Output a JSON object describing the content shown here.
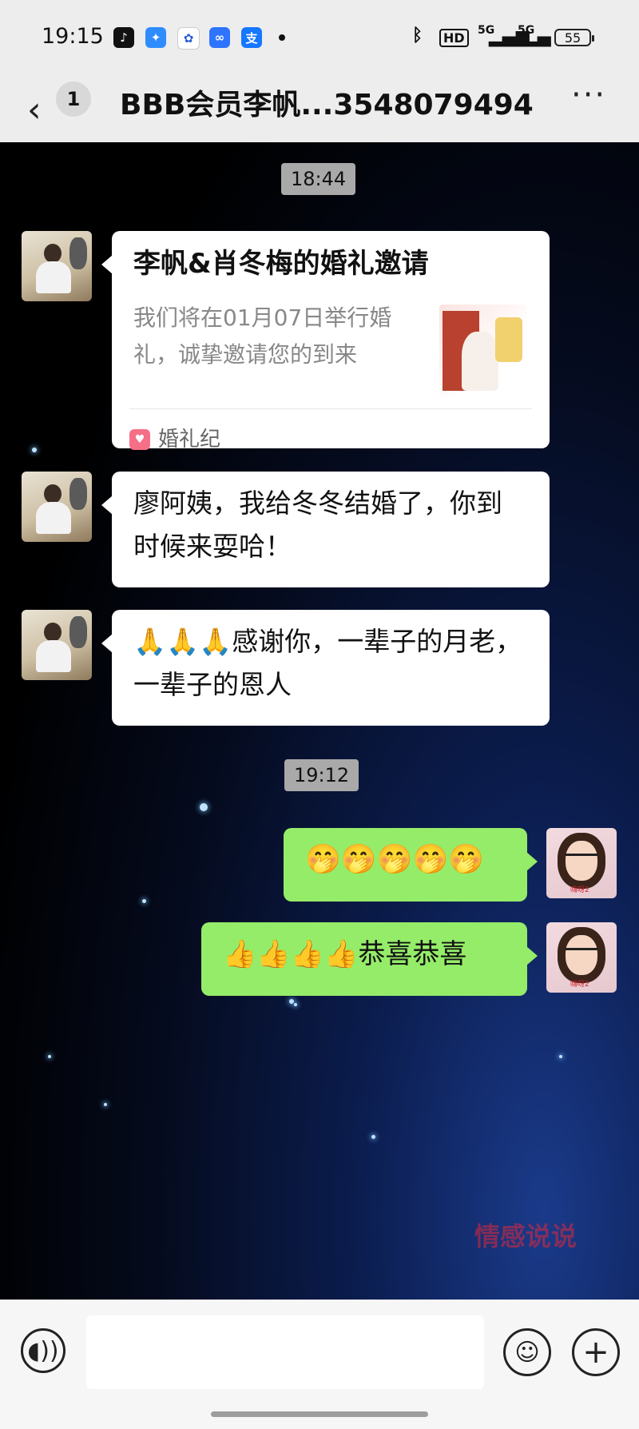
{
  "status_bar": {
    "time": "19:15",
    "network1": "5G",
    "network2": "5G",
    "hd": "HD",
    "battery": "55",
    "app_icons": [
      "tiktok-icon",
      "blue-bird-icon",
      "baidu-paw-icon",
      "infinity-icon",
      "alipay-icon"
    ]
  },
  "nav": {
    "back_symbol": "‹",
    "unread_count": "1",
    "title": "BBB会员李帆...3548079494",
    "more_symbol": "···"
  },
  "chat": {
    "timestamps": [
      "18:44",
      "19:12"
    ],
    "invite_card": {
      "title": "李帆&肖冬梅的婚礼邀请",
      "description": "我们将在01月07日举行婚礼，诚挚邀请您的到来",
      "source": "婚礼纪"
    },
    "messages": [
      {
        "sender": "left",
        "text": "廖阿姨，我给冬冬结婚了，你到时候来耍哈！"
      },
      {
        "sender": "left",
        "text": "🙏🙏🙏感谢你，一辈子的月老，一辈子的恩人"
      },
      {
        "sender": "right",
        "text": "🤭🤭🤭🤭🤭"
      },
      {
        "sender": "right",
        "text": "👍👍👍👍恭喜恭喜"
      }
    ],
    "right_avatar_tag": "嗨呀2"
  },
  "watermark": "情感说说",
  "input_bar": {
    "voice_icon": "voice-icon",
    "emoji_icon": "emoji-icon",
    "plus_icon": "plus-icon"
  },
  "colors": {
    "header_bg": "#ededed",
    "bubble_sent": "#95ec69",
    "bubble_received": "#ffffff"
  }
}
